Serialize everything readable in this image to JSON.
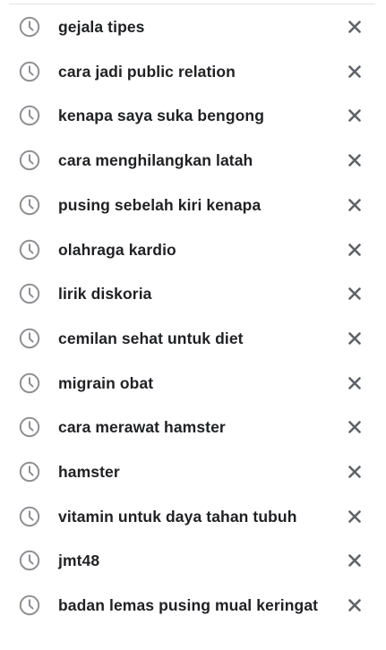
{
  "search_history": {
    "items": [
      {
        "query": "gejala tipes"
      },
      {
        "query": "cara jadi public relation"
      },
      {
        "query": "kenapa saya suka bengong"
      },
      {
        "query": "cara menghilangkan latah"
      },
      {
        "query": "pusing sebelah kiri kenapa"
      },
      {
        "query": "olahraga kardio"
      },
      {
        "query": "lirik diskoria"
      },
      {
        "query": "cemilan sehat untuk diet"
      },
      {
        "query": "migrain obat"
      },
      {
        "query": "cara merawat hamster"
      },
      {
        "query": "hamster"
      },
      {
        "query": "vitamin untuk daya tahan tubuh"
      },
      {
        "query": "jmt48"
      },
      {
        "query": "badan lemas pusing mual keringat"
      }
    ],
    "item_icon": "history-clock-icon",
    "remove_icon": "close-icon"
  },
  "colors": {
    "text": "#202124",
    "icon": "#8e8e93",
    "remove_icon": "#5f6368",
    "divider": "#e3e3e3",
    "background": "#ffffff"
  }
}
